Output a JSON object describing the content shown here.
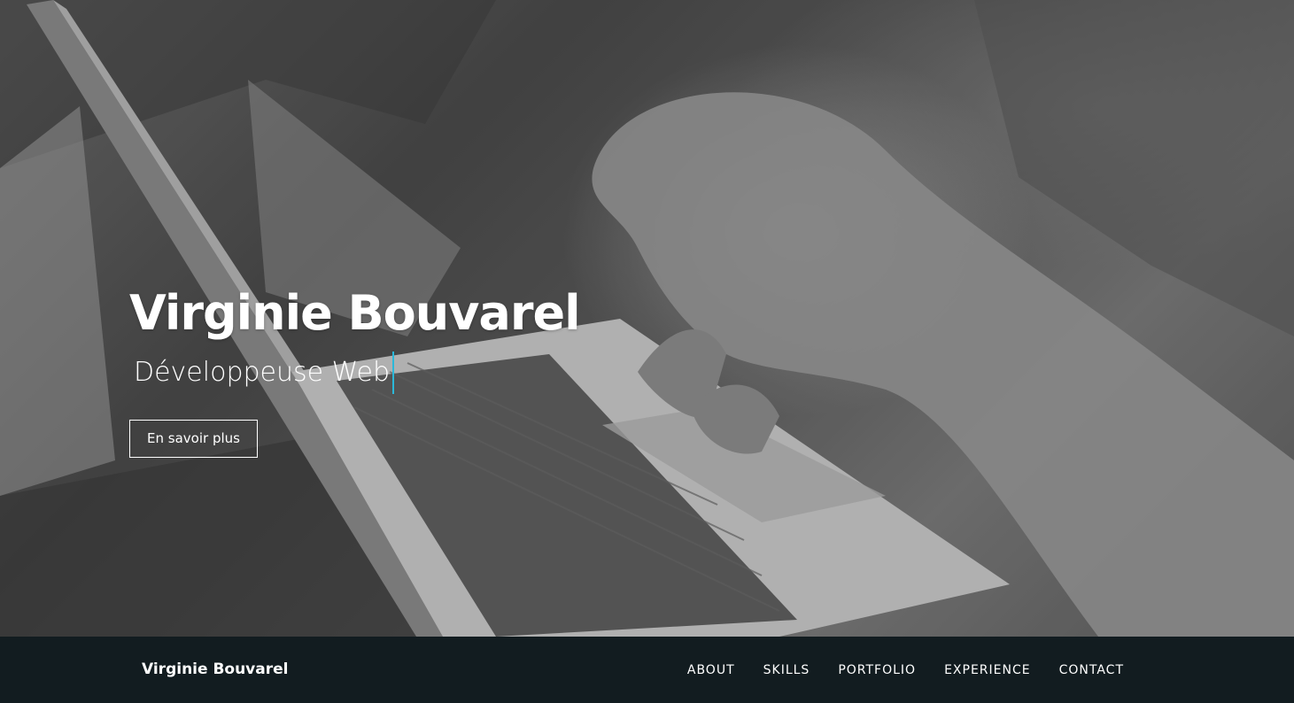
{
  "hero": {
    "title": "Virginie Bouvarel",
    "subtitle": "Développeuse Web",
    "cta_label": "En savoir plus",
    "background_image": "grayscale photo of hands typing on a laptop keyboard"
  },
  "navbar": {
    "brand": "Virginie Bouvarel",
    "items": [
      {
        "label": "ABOUT"
      },
      {
        "label": "SKILLS"
      },
      {
        "label": "PORTFOLIO"
      },
      {
        "label": "EXPERIENCE"
      },
      {
        "label": "CONTACT"
      }
    ]
  },
  "colors": {
    "navbar_bg": "#121c20",
    "cursor_accent": "#2bb8d9",
    "text": "#ffffff"
  }
}
